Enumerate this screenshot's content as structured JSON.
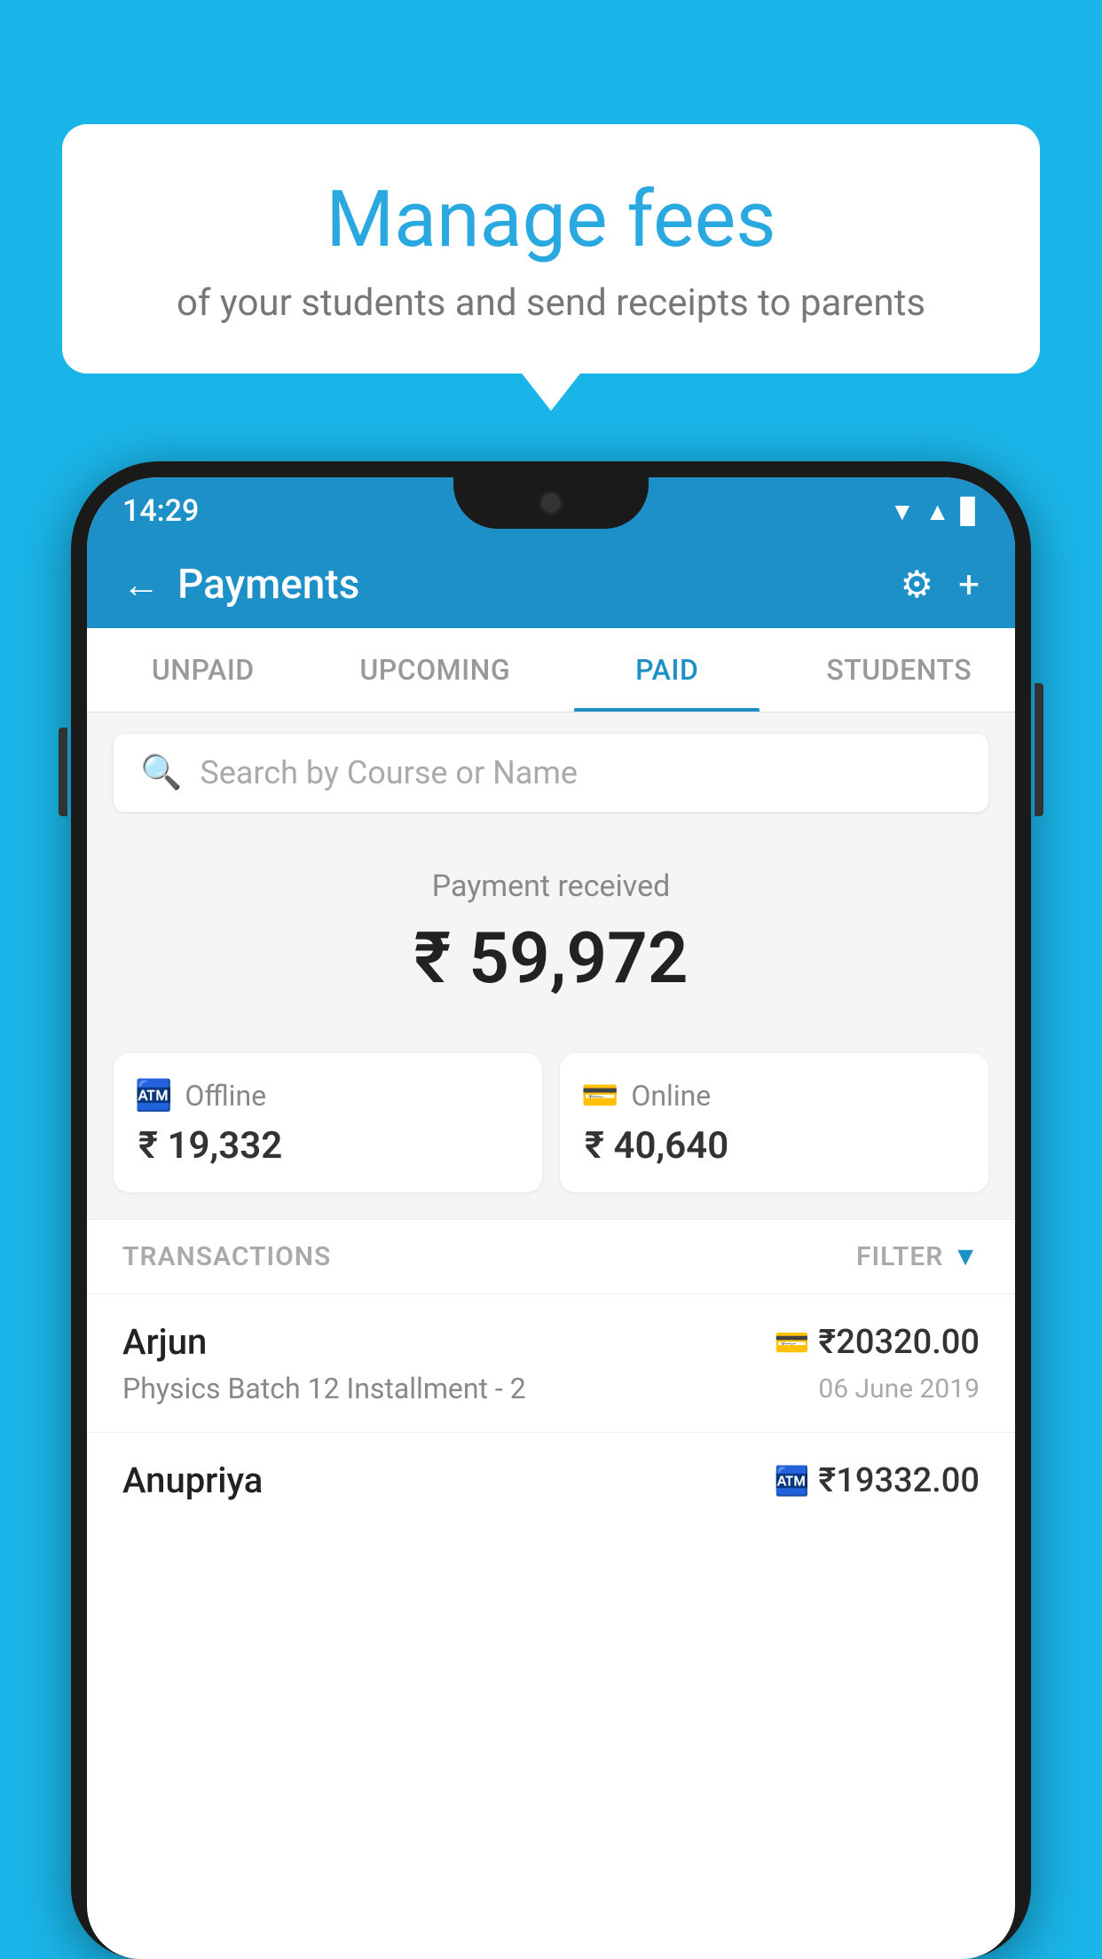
{
  "background_color": "#1ab5e8",
  "speech_bubble": {
    "title": "Manage fees",
    "subtitle": "of your students and send receipts to parents"
  },
  "status_bar": {
    "time": "14:29",
    "wifi_icon": "▼",
    "signal_icon": "▲",
    "battery_icon": "▐"
  },
  "header": {
    "title": "Payments",
    "back_label": "←",
    "settings_label": "⚙",
    "add_label": "+"
  },
  "tabs": [
    {
      "label": "UNPAID",
      "active": false
    },
    {
      "label": "UPCOMING",
      "active": false
    },
    {
      "label": "PAID",
      "active": true
    },
    {
      "label": "STUDENTS",
      "active": false
    }
  ],
  "search": {
    "placeholder": "Search by Course or Name"
  },
  "payment_summary": {
    "received_label": "Payment received",
    "total_amount": "₹ 59,972",
    "offline_label": "Offline",
    "offline_amount": "₹ 19,332",
    "online_label": "Online",
    "online_amount": "₹ 40,640"
  },
  "transactions": {
    "section_label": "TRANSACTIONS",
    "filter_label": "FILTER",
    "rows": [
      {
        "name": "Arjun",
        "course": "Physics Batch 12 Installment - 2",
        "amount": "₹20320.00",
        "date": "06 June 2019",
        "payment_type": "card"
      },
      {
        "name": "Anupriya",
        "course": "",
        "amount": "₹19332.00",
        "date": "",
        "payment_type": "cash"
      }
    ]
  }
}
